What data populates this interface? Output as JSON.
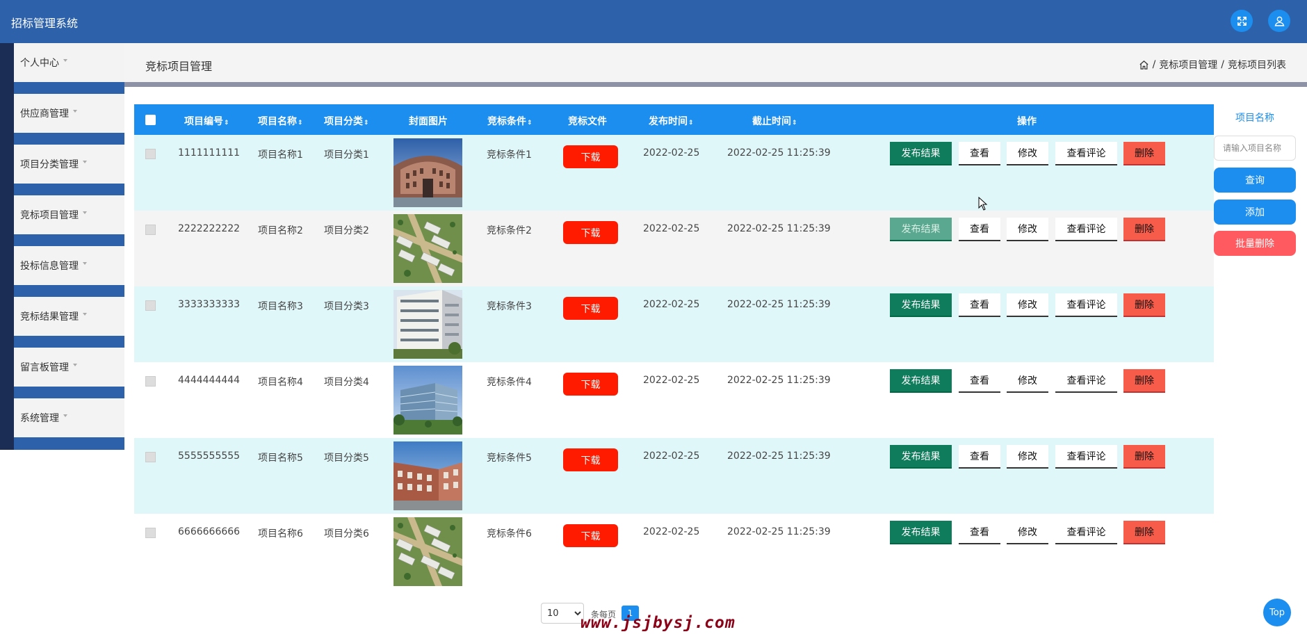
{
  "app": {
    "title": "招标管理系统"
  },
  "topbar": {
    "icons": [
      "fullscreen-icon",
      "user-icon"
    ]
  },
  "sidebar": {
    "items": [
      {
        "label": "个人中心"
      },
      {
        "label": "供应商管理"
      },
      {
        "label": "项目分类管理"
      },
      {
        "label": "竞标项目管理"
      },
      {
        "label": "投标信息管理"
      },
      {
        "label": "竞标结果管理"
      },
      {
        "label": "留言板管理"
      },
      {
        "label": "系统管理"
      }
    ]
  },
  "header": {
    "title": "竞标项目管理",
    "breadcrumb": [
      "竞标项目管理",
      "竞标项目列表"
    ],
    "separator": "/"
  },
  "table": {
    "columns": [
      "项目编号",
      "项目名称",
      "项目分类",
      "封面图片",
      "竞标条件",
      "竞标文件",
      "发布时间",
      "截止时间",
      "操作"
    ],
    "sort_icon": "⇕",
    "rows": [
      {
        "id": "1111111111",
        "name": "项目名称1",
        "category": "项目分类1",
        "condition": "竞标条件1",
        "publish": "2022-02-25",
        "deadline": "2022-02-25 11:25:39",
        "cover": "building-plaza"
      },
      {
        "id": "2222222222",
        "name": "项目名称2",
        "category": "项目分类2",
        "condition": "竞标条件2",
        "publish": "2022-02-25",
        "deadline": "2022-02-25 11:25:39",
        "cover": "aerial-campus"
      },
      {
        "id": "3333333333",
        "name": "项目名称3",
        "category": "项目分类3",
        "condition": "竞标条件3",
        "publish": "2022-02-25",
        "deadline": "2022-02-25 11:25:39",
        "cover": "white-apartment"
      },
      {
        "id": "4444444444",
        "name": "项目名称4",
        "category": "项目分类4",
        "condition": "竞标条件4",
        "publish": "2022-02-25",
        "deadline": "2022-02-25 11:25:39",
        "cover": "glass-tower"
      },
      {
        "id": "5555555555",
        "name": "项目名称5",
        "category": "项目分类5",
        "condition": "竞标条件5",
        "publish": "2022-02-25",
        "deadline": "2022-02-25 11:25:39",
        "cover": "brick-building"
      },
      {
        "id": "6666666666",
        "name": "项目名称6",
        "category": "项目分类6",
        "condition": "竞标条件6",
        "publish": "2022-02-25",
        "deadline": "2022-02-25 11:25:39",
        "cover": "aerial-campus"
      }
    ],
    "actions": {
      "download": "下载",
      "publish": "发布结果",
      "view": "查看",
      "edit": "修改",
      "comments": "查看评论",
      "delete": "删除"
    }
  },
  "search": {
    "label": "项目名称",
    "placeholder": "请输入项目名称",
    "query_button": "查询",
    "add_button": "添加",
    "batch_delete_button": "批量删除"
  },
  "pagination": {
    "page_size": "10",
    "per_page_label": "条每页",
    "current_page": "1"
  },
  "watermark": "www.jsjbysj.com",
  "back_to_top": "Top",
  "colors": {
    "topbar": "#2d62ab",
    "table_header": "#1b8ef0",
    "download": "#ff1b00",
    "publish": "#0f7c5c",
    "delete": "#f75c4a",
    "batch_delete": "#ff5a5f"
  }
}
